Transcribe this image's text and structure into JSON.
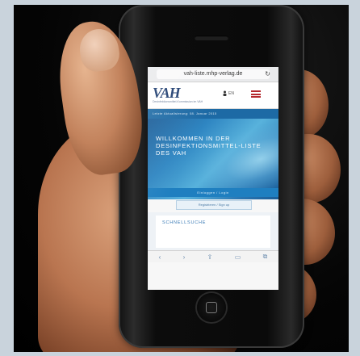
{
  "browser": {
    "url": "vah-liste.mhp-verlag.de",
    "reload_icon": "reload-icon"
  },
  "site": {
    "logo": "VAH",
    "logo_subtitle": "Desinfektionsmittel-Kommission im VAH",
    "lang": "EN",
    "date_strip": "Letzte Aktualisierung: 08. Januar 2015",
    "hero_title": "Willkommen in der Desinfektionsmittel-Liste des VAH",
    "primary_button": "Einloggen / Login",
    "secondary_button": "Registrieren / Sign up",
    "section_title": "Schnellsuche"
  },
  "toolbar": {
    "back": "‹",
    "forward": "›",
    "share": "⇪",
    "bookmarks": "▭",
    "tabs": "⧉"
  },
  "colors": {
    "accent_blue": "#1f7fc0",
    "logo_blue": "#1d3c6f",
    "menu_red": "#b4282d"
  }
}
